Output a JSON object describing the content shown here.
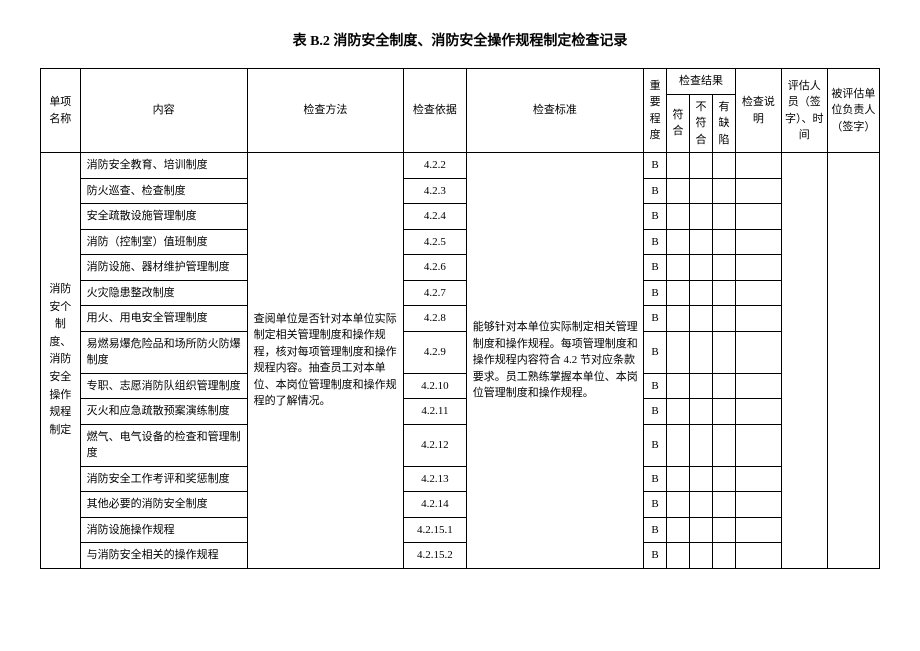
{
  "title": "表 B.2 消防安全制度、消防安全操作规程制定检查记录",
  "headers": {
    "item_name": "单项名称",
    "content": "内容",
    "method": "检查方法",
    "basis": "检查依据",
    "standard": "检查标准",
    "level": "重要程度",
    "result": "检查结果",
    "result_pass": "符合",
    "result_fail": "不符合",
    "result_missing": "有缺陷",
    "desc": "检查说明",
    "assessor": "评估人员（签字）、时间",
    "owner": "被评估单位负责人（签字）"
  },
  "category": "消防安个制度、消防安全操作规程制定",
  "method_text": "查阅单位是否针对本单位实际制定相关管理制度和操作规程，核对每项管理制度和操作规程内容。抽查员工对本单位、本岗位管理制度和操作规程的了解情况。",
  "standard_text": "能够针对本单位实际制定相关管理制度和操作规程。每项管理制度和操作规程内容符合 4.2 节对应条款要求。员工熟练掌握本单位、本岗位管理制度和操作规程。",
  "level_value": "B",
  "rows": [
    {
      "content": "消防安全教育、培训制度",
      "basis": "4.2.2"
    },
    {
      "content": "防火巡查、检查制度",
      "basis": "4.2.3"
    },
    {
      "content": "安全疏散设施管理制度",
      "basis": "4.2.4"
    },
    {
      "content": "消防（控制室）值班制度",
      "basis": "4.2.5"
    },
    {
      "content": "消防设施、器材维护管理制度",
      "basis": "4.2.6"
    },
    {
      "content": "火灾隐患整改制度",
      "basis": "4.2.7"
    },
    {
      "content": "用火、用电安全管理制度",
      "basis": "4.2.8"
    },
    {
      "content": "易燃易爆危险品和场所防火防爆制度",
      "basis": "4.2.9"
    },
    {
      "content": "专职、志愿消防队组织管理制度",
      "basis": "4.2.10"
    },
    {
      "content": "灭火和应急疏散预案演练制度",
      "basis": "4.2.11"
    },
    {
      "content": "燃气、电气设备的检查和管理制度",
      "basis": "4.2.12"
    },
    {
      "content": "消防安全工作考评和奖惩制度",
      "basis": "4.2.13"
    },
    {
      "content": "其他必要的消防安全制度",
      "basis": "4.2.14"
    },
    {
      "content": "消防设施操作规程",
      "basis": "4.2.15.1"
    },
    {
      "content": "与消防安全相关的操作规程",
      "basis": "4.2.15.2"
    }
  ]
}
